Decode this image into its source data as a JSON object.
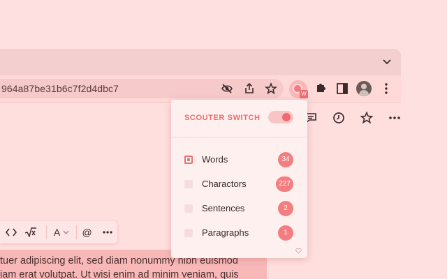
{
  "browser": {
    "url": "964a87be31b6c7f2d4dbc7",
    "extension_badge": "W"
  },
  "format_toolbar": {
    "font_label": "A",
    "mention": "@"
  },
  "body_text": {
    "line1": "tuer adipiscing elit, sed diam nonummy nibh euismod",
    "line2": "iam erat volutpat. Ut wisi enim ad minim veniam, quis"
  },
  "popup": {
    "switch_label": "SCOUTER SWITCH",
    "switch_on": true,
    "rows": [
      {
        "label": "Words",
        "count": "34",
        "checked": true
      },
      {
        "label": "Charactors",
        "count": "227",
        "checked": false
      },
      {
        "label": "Sentences",
        "count": "2",
        "checked": false
      },
      {
        "label": "Paragraphs",
        "count": "1",
        "checked": false
      }
    ]
  },
  "colors": {
    "accent": "#f06b6e",
    "page_bg": "#ffe0e0",
    "selection": "#f8b8b8"
  }
}
